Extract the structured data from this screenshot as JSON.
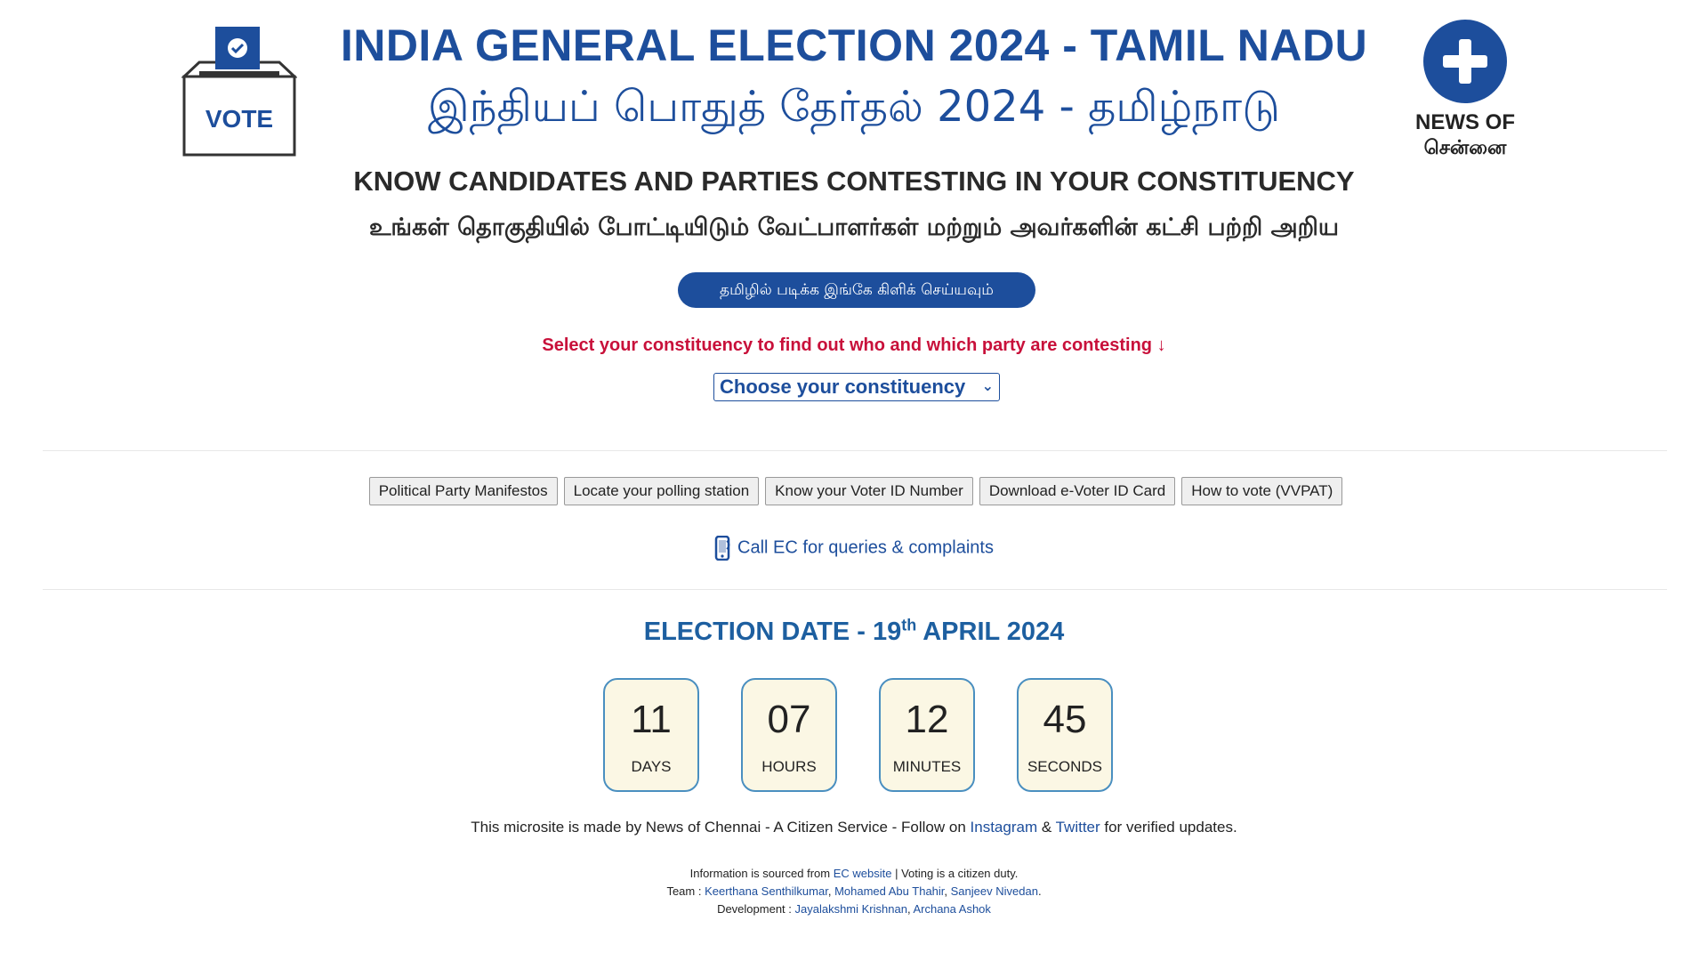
{
  "header": {
    "title_en": "INDIA GENERAL ELECTION 2024 - TAMIL NADU",
    "title_ta": "இந்தியப் பொதுத் தேர்தல் 2024 - தமிழ்நாடு",
    "vote_logo_text": "VOTE",
    "news_label": "NEWS OF",
    "news_label_ta": "சென்னை"
  },
  "intro": {
    "know_en": "KNOW CANDIDATES AND PARTIES CONTESTING IN YOUR CONSTITUENCY",
    "know_ta": "உங்கள் தொகுதியில் போட்டியிடும் வேட்பாளர்கள் மற்றும் அவர்களின் கட்சி பற்றி அறிய",
    "tamil_button": "தமிழில் படிக்க இங்கே கிளிக் செய்யவும்"
  },
  "selector": {
    "prompt": "Select your constituency to find out who and which party are contesting ↓",
    "selected": "Choose your constituency"
  },
  "links": [
    "Political Party Manifestos",
    "Locate your polling station",
    "Know your Voter ID Number",
    "Download e-Voter ID Card",
    "How to vote (VVPAT)"
  ],
  "call_ec": "Call EC for queries & complaints",
  "election": {
    "prefix": "ELECTION DATE - 19",
    "sup": "th",
    "suffix": " APRIL 2024"
  },
  "countdown": [
    {
      "value": "11",
      "label": "DAYS"
    },
    {
      "value": "07",
      "label": "HOURS"
    },
    {
      "value": "12",
      "label": "MINUTES"
    },
    {
      "value": "45",
      "label": "SECONDS"
    }
  ],
  "footer": {
    "line1_a": "This microsite is made by News of Chennai - A Citizen Service - Follow on ",
    "instagram": "Instagram",
    "amp": " & ",
    "twitter": "Twitter",
    "line1_b": " for verified updates.",
    "info_a": "Information is sourced from ",
    "ec_website": "EC website",
    "info_b": " | Voting is a citizen duty.",
    "team_label": "Team : ",
    "team_1": "Keerthana Senthilkumar",
    "team_2": "Mohamed Abu Thahir",
    "team_3": "Sanjeev Nivedan",
    "team_end": ".",
    "dev_label": "Development : ",
    "dev_1": "Jayalakshmi Krishnan",
    "dev_2": "Archana Ashok",
    "comma": ", "
  },
  "colors": {
    "primary_blue": "#1d4e9c",
    "prompt_red": "#c8103a",
    "countdown_bg": "#fbf7e4"
  }
}
